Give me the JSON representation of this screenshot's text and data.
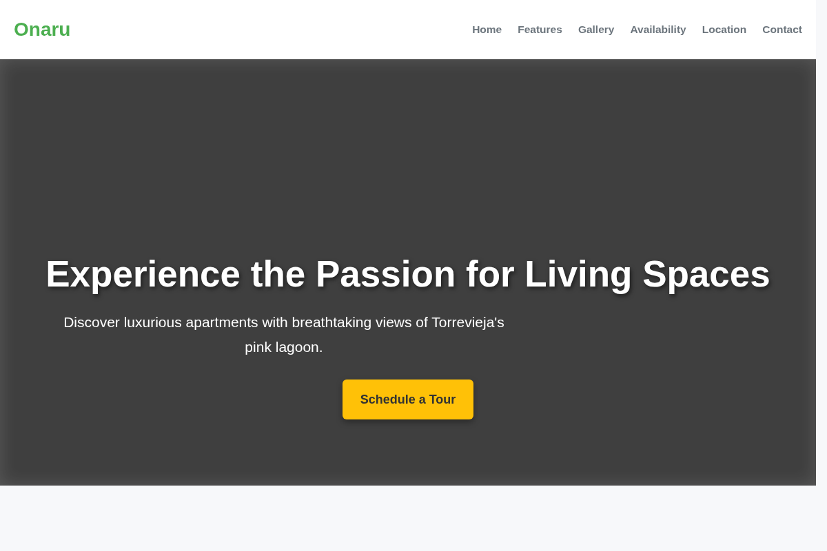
{
  "header": {
    "logo": "Onaru",
    "nav": [
      "Home",
      "Features",
      "Gallery",
      "Availability",
      "Location",
      "Contact"
    ]
  },
  "hero": {
    "title": "Experience the Passion for Living Spaces",
    "subtitle": "Discover luxurious apartments with breathtaking views of Torrevieja's pink lagoon.",
    "button": "Schedule a Tour"
  }
}
